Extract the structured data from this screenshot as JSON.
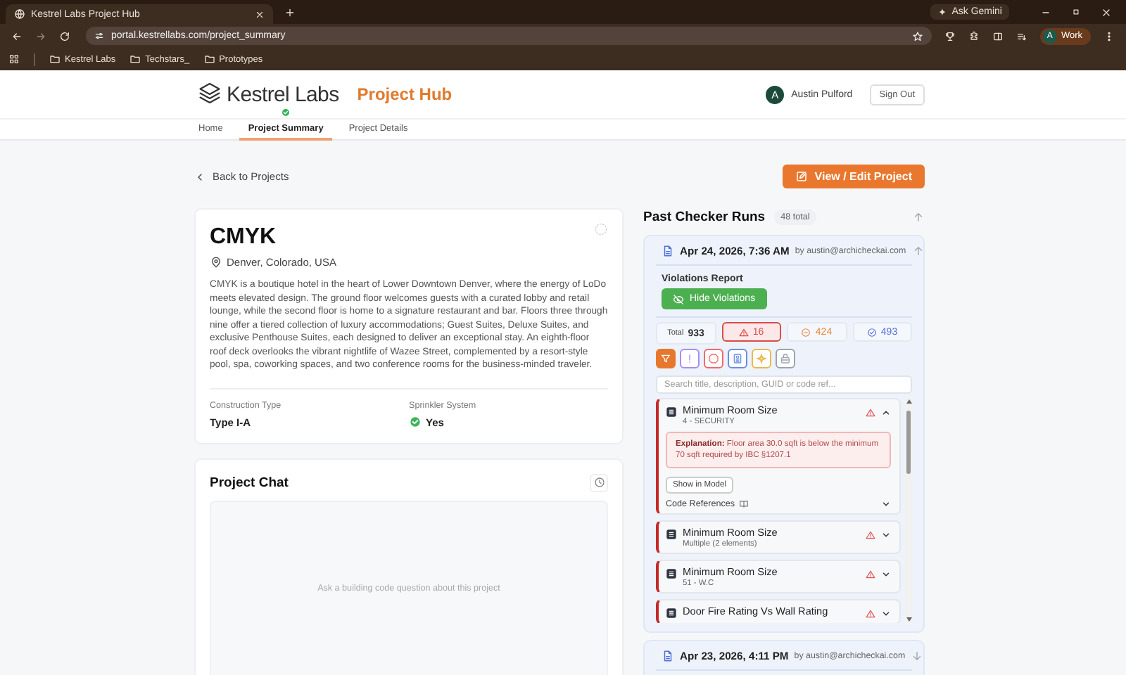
{
  "browser": {
    "tab_title": "Kestrel Labs Project Hub",
    "url": "portal.kestrellabs.com/project_summary",
    "ask_button": "Ask Gemini",
    "profile_initial": "A",
    "profile_label": "Work",
    "bookmarks": [
      "Kestrel Labs",
      "Techstars_",
      "Prototypes"
    ]
  },
  "header": {
    "brand": "Kestrel Labs",
    "app_title": "Project Hub",
    "user_initial": "A",
    "user_name": "Austin Pulford",
    "sign_out": "Sign Out"
  },
  "nav": [
    {
      "label": "Home",
      "selected": false
    },
    {
      "label": "Project Summary",
      "selected": true
    },
    {
      "label": "Project Details",
      "selected": false
    }
  ],
  "back_link": "Back to Projects",
  "edit_button": "View / Edit Project",
  "project": {
    "name": "CMYK",
    "location": "Denver, Colorado, USA",
    "description": "CMYK is a boutique hotel in the heart of Lower Downtown Denver, where the energy of LoDo meets elevated design. The ground floor welcomes guests with a curated lobby and retail lounge, while the second floor is home to a signature restaurant and bar. Floors three through nine offer a tiered collection of luxury accommodations; Guest Suites, Deluxe Suites, and exclusive Penthouse Suites, each designed to deliver an exceptional stay. An eighth-floor roof deck overlooks the vibrant nightlife of Wazee Street, complemented by a resort-style pool, spa, coworking spaces, and two conference rooms for the business-minded traveler.",
    "fields": [
      {
        "label": "Construction Type",
        "value": "Type I-A",
        "kind": "text"
      },
      {
        "label": "Sprinkler System",
        "value": "Yes",
        "kind": "check"
      }
    ]
  },
  "chat": {
    "title": "Project Chat",
    "empty_message": "Ask a building code question about this project"
  },
  "runs": {
    "title": "Past Checker Runs",
    "count": "48 total",
    "items": [
      {
        "date": "Apr 24, 2026, 7:36 AM",
        "by": "by austin@archicheckai.com",
        "expanded": true,
        "report": {
          "title": "Violations Report",
          "toggle_button": "Hide Violations",
          "total_label": "Total",
          "total": "933",
          "stats": [
            {
              "value": "16",
              "color": "#dc4a4a",
              "selected": true
            },
            {
              "value": "424",
              "color": "#e8863a",
              "selected": false
            },
            {
              "value": "493",
              "color": "#4f6fe0",
              "selected": false
            }
          ],
          "filters": [
            {
              "color": "#e8772e",
              "selected": true
            },
            {
              "color": "#a78bfa",
              "selected": false
            },
            {
              "color": "#ef6b6b",
              "selected": false
            },
            {
              "color": "#6b8fe8",
              "selected": false
            },
            {
              "color": "#eab94a",
              "selected": false
            },
            {
              "color": "#9ca3af",
              "selected": false
            }
          ],
          "search_placeholder": "Search title, description, GUID or code ref...",
          "violations": [
            {
              "title": "Minimum Room Size",
              "subtitle": "4 - SECURITY",
              "expanded": true,
              "explanation": "**Explanation:** Floor area 30.0 sqft is below the minimum 70 sqft required by IBC §1207.1",
              "action_button": "Show in Model",
              "references": "Code References"
            },
            {
              "title": "Minimum Room Size",
              "subtitle": "Multiple (2 elements)",
              "expanded": false
            },
            {
              "title": "Minimum Room Size",
              "subtitle": "51 - W.C",
              "expanded": false
            },
            {
              "title": "Door Fire Rating Vs Wall Rating",
              "expanded": false
            }
          ]
        }
      },
      {
        "date": "Apr 23, 2026, 4:11 PM",
        "by": "by austin@archicheckai.com",
        "expanded": false
      }
    ]
  }
}
